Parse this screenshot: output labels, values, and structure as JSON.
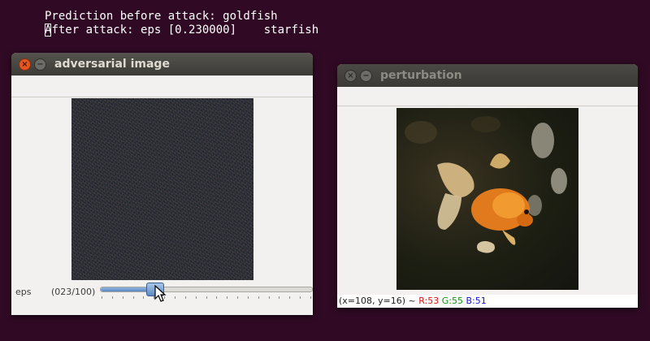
{
  "terminal": {
    "line1": "Prediction before attack: goldfish",
    "line2_first_char": "A",
    "line2_rest": "fter attack: eps [0.230000]    starfish"
  },
  "adversarial_window": {
    "title": "adversarial image",
    "close_glyph": "×",
    "minimize_glyph": "−",
    "slider": {
      "label": "eps",
      "value_text": "(023/100)",
      "value": 23,
      "max": 100,
      "tick_count": 21
    }
  },
  "perturbation_window": {
    "title": "perturbation",
    "close_glyph": "×",
    "minimize_glyph": "−",
    "status": {
      "coords": "(x=108, y=16) ~",
      "r": "R:53",
      "g": "G:55",
      "b": "B:51"
    }
  },
  "colors": {
    "terminal_bg": "#300a24",
    "close_button": "#e9541f",
    "slider_fill": "#5a87c5"
  }
}
